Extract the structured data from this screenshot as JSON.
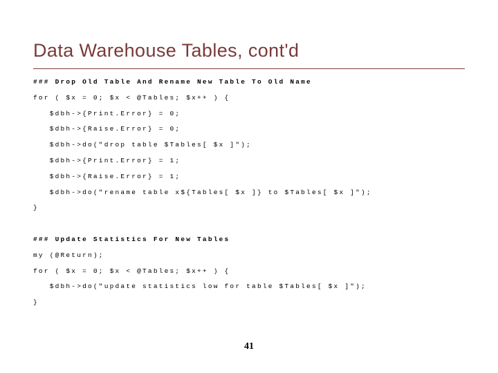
{
  "title": "Data Warehouse Tables, cont'd",
  "page_number": "41",
  "code": {
    "c1": "### Drop Old Table And Rename New Table To Old Name",
    "l1": "for ( $x = 0; $x < @Tables; $x++ ) {",
    "l2": "   $dbh->{Print.Error} = 0;",
    "l3": "   $dbh->{Raise.Error} = 0;",
    "l4": "   $dbh->do(\"drop table $Tables[ $x ]\");",
    "l5": "   $dbh->{Print.Error} = 1;",
    "l6": "   $dbh->{Raise.Error} = 1;",
    "l7": "   $dbh->do(\"rename table x${Tables[ $x ]} to $Tables[ $x ]\");",
    "l8": "}",
    "c2": "### Update Statistics For New Tables",
    "l9": "my (@Return);",
    "l10": "for ( $x = 0; $x < @Tables; $x++ ) {",
    "l11": "   $dbh->do(\"update statistics low for table $Tables[ $x ]\");",
    "l12": "}"
  }
}
